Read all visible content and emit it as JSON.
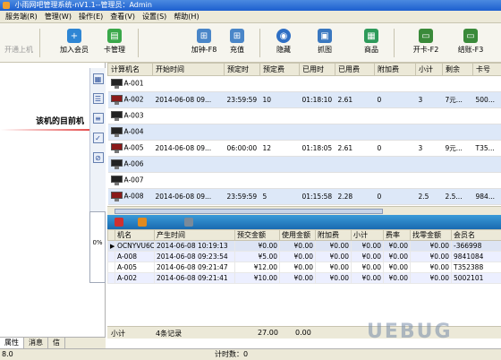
{
  "window": {
    "title": "小雨网吧管理系统-nV1.1--管理员：Admin"
  },
  "menu": [
    "服务端(R)",
    "管理(W)",
    "操作(E)",
    "查看(V)",
    "设置(S)",
    "帮助(H)"
  ],
  "toolbar": {
    "open_machine": "开通上机",
    "add_member": "加入会员",
    "card_manage": "卡管理",
    "add_clock": "加钟-F8",
    "recharge": "充值",
    "hide": "隐藏",
    "screenshot": "抓图",
    "goods": "商品",
    "open_card": "开卡-F2",
    "checkout": "结账-F3"
  },
  "left_panel": {
    "info_text": "该机的目前机",
    "progress_pct": "0%",
    "tabs": [
      "属性",
      "消息",
      "信"
    ]
  },
  "machines": {
    "columns": [
      "计算机名",
      "开始时间",
      "预定时",
      "预定费",
      "已用时",
      "已用费",
      "附加费",
      "小计",
      "剩余",
      "卡号"
    ],
    "rows": [
      {
        "name": "A-001",
        "start": "",
        "plan_time": "",
        "plan_fee": "",
        "used_time": "",
        "used_fee": "",
        "extra": "",
        "subtotal": "",
        "remain": "",
        "card": "",
        "on": false
      },
      {
        "name": "A-002",
        "start": "2014-06-08 09...",
        "plan_time": "23:59:59",
        "plan_fee": "10",
        "used_time": "01:18:10",
        "used_fee": "2.61",
        "extra": "0",
        "subtotal": "3",
        "remain": "7元...",
        "card": "500...",
        "on": true
      },
      {
        "name": "A-003",
        "start": "",
        "plan_time": "",
        "plan_fee": "",
        "used_time": "",
        "used_fee": "",
        "extra": "",
        "subtotal": "",
        "remain": "",
        "card": "",
        "on": false
      },
      {
        "name": "A-004",
        "start": "",
        "plan_time": "",
        "plan_fee": "",
        "used_time": "",
        "used_fee": "",
        "extra": "",
        "subtotal": "",
        "remain": "",
        "card": "",
        "on": false
      },
      {
        "name": "A-005",
        "start": "2014-06-08 09...",
        "plan_time": "06:00:00",
        "plan_fee": "12",
        "used_time": "01:18:05",
        "used_fee": "2.61",
        "extra": "0",
        "subtotal": "3",
        "remain": "9元...",
        "card": "T35...",
        "on": true
      },
      {
        "name": "A-006",
        "start": "",
        "plan_time": "",
        "plan_fee": "",
        "used_time": "",
        "used_fee": "",
        "extra": "",
        "subtotal": "",
        "remain": "",
        "card": "",
        "on": false
      },
      {
        "name": "A-007",
        "start": "",
        "plan_time": "",
        "plan_fee": "",
        "used_time": "",
        "used_fee": "",
        "extra": "",
        "subtotal": "",
        "remain": "",
        "card": "",
        "on": false
      },
      {
        "name": "A-008",
        "start": "2014-06-08 09...",
        "plan_time": "23:59:59",
        "plan_fee": "5",
        "used_time": "01:15:58",
        "used_fee": "2.28",
        "extra": "0",
        "subtotal": "2.5",
        "remain": "2.5...",
        "card": "984...",
        "on": true
      }
    ]
  },
  "records": {
    "columns": [
      "机名",
      "产生时间",
      "预交金额",
      "使用金额",
      "附加费",
      "小计",
      "费率",
      "找零金额",
      "会员名"
    ],
    "rows": [
      {
        "marker": "▶",
        "machine": "OCNYVU6CTV",
        "time": "2014-06-08 10:19:13",
        "prepaid": "¥0.00",
        "used": "¥0.00",
        "extra": "¥0.00",
        "subtotal": "¥0.00",
        "rate": "¥0.00",
        "change": "¥0.00",
        "member": "-366998"
      },
      {
        "marker": "",
        "machine": "A-008",
        "time": "2014-06-08 09:23:54",
        "prepaid": "¥5.00",
        "used": "¥0.00",
        "extra": "¥0.00",
        "subtotal": "¥0.00",
        "rate": "¥0.00",
        "change": "¥0.00",
        "member": "9841084"
      },
      {
        "marker": "",
        "machine": "A-005",
        "time": "2014-06-08 09:21:47",
        "prepaid": "¥12.00",
        "used": "¥0.00",
        "extra": "¥0.00",
        "subtotal": "¥0.00",
        "rate": "¥0.00",
        "change": "¥0.00",
        "member": "T352388"
      },
      {
        "marker": "",
        "machine": "A-002",
        "time": "2014-06-08 09:21:41",
        "prepaid": "¥10.00",
        "used": "¥0.00",
        "extra": "¥0.00",
        "subtotal": "¥0.00",
        "rate": "¥0.00",
        "change": "¥0.00",
        "member": "5002101"
      }
    ],
    "summary": {
      "label": "小计",
      "count": "4条记录",
      "total": "27.00",
      "used": "0.00"
    }
  },
  "status": {
    "counter": "计时数：0",
    "left_text": "8.0"
  },
  "watermark": "UEBUG"
}
